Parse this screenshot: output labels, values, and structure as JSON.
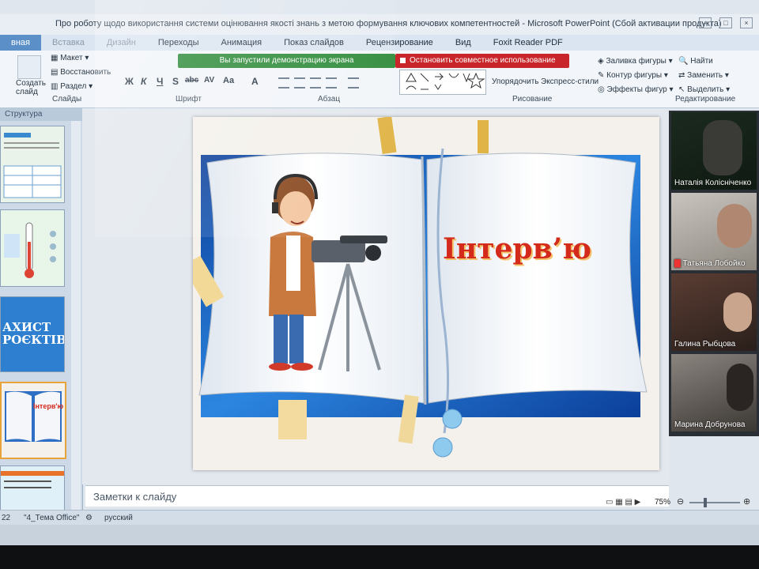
{
  "window": {
    "title": "Про роботу щодо використання системи оцінювання якості знань з метою формування ключових компетентностей - Microsoft PowerPoint (Сбой активации продукта)"
  },
  "tabs": [
    {
      "label": "вная",
      "active": true
    },
    {
      "label": "Вставка"
    },
    {
      "label": "Дизайн"
    },
    {
      "label": "Переходы"
    },
    {
      "label": "Анимация"
    },
    {
      "label": "Показ слайдов"
    },
    {
      "label": "Рецензирование"
    },
    {
      "label": "Вид"
    },
    {
      "label": "Foxit Reader PDF"
    }
  ],
  "ribbon": {
    "slides_group": {
      "create_slide": "Создать слайд",
      "layout": "Макет",
      "restore": "Восстановить",
      "section": "Раздел",
      "label": "Слайды"
    },
    "font_group": {
      "label": "Шрифт",
      "buttons": [
        "Ж",
        "К",
        "Ч",
        "S",
        "abc",
        "AV",
        "Aa",
        "A"
      ]
    },
    "paragraph_group": {
      "label": "Абзац"
    },
    "drawing_group": {
      "label": "Рисование",
      "arrange": "Упорядочить",
      "quick_styles": "Экспресс-стили",
      "fill": "Заливка фигуры",
      "outline": "Контур фигуры",
      "effects": "Эффекты фигур"
    },
    "editing_group": {
      "label": "Редактирование",
      "find": "Найти",
      "replace": "Заменить",
      "select": "Выделить"
    },
    "share_banner": "Вы запустили демонстрацию экрана",
    "stop_share": "Остановить совместное использование"
  },
  "left_pane": {
    "header": "Структура",
    "thumb3_text": [
      "АХИСТ",
      "РОЄКТІВ"
    ],
    "thumb4_text": "Інтерв'ю"
  },
  "slide": {
    "title": "Інтерв’ю"
  },
  "participants": [
    {
      "name": "Наталія Колісніченко"
    },
    {
      "name": "Татьяна Лобойко"
    },
    {
      "name": "Галина Рыбцова"
    },
    {
      "name": "Марина Добрунова"
    }
  ],
  "notes_placeholder": "Заметки к слайду",
  "status": {
    "slide_num": "22",
    "theme": "\"4_Тема Office\"",
    "language": "русский",
    "zoom": "75%"
  },
  "colors": {
    "share_green": "#2e8b3a",
    "stop_red": "#c8262a",
    "title_red": "#d42a1c"
  }
}
